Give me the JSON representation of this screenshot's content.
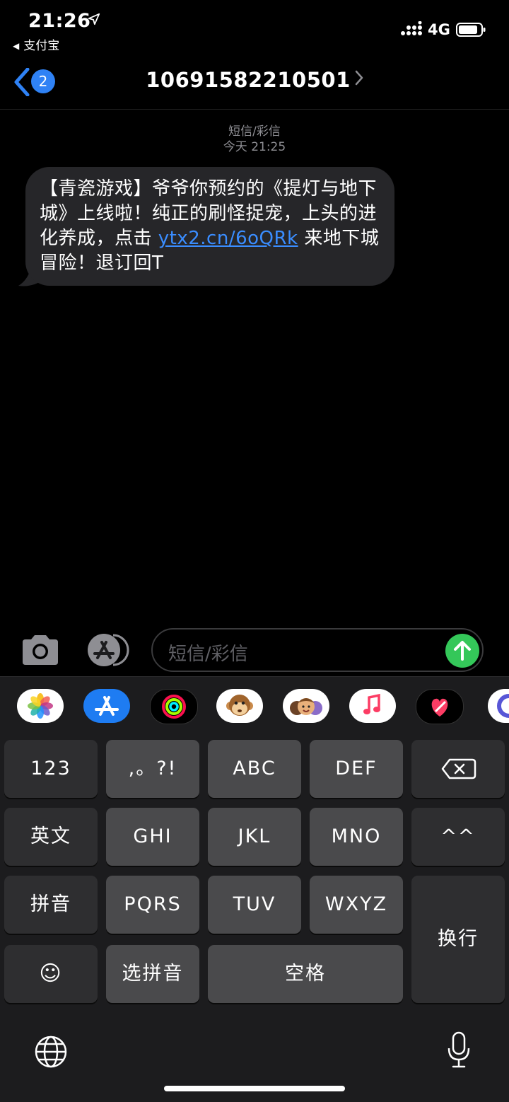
{
  "status_bar": {
    "time": "21:26",
    "back_app": "支付宝",
    "network": "4G"
  },
  "header": {
    "back_badge": "2",
    "title": "10691582210501"
  },
  "thread": {
    "type_label": "短信/彩信",
    "timestamp": "今天 21:25",
    "message": {
      "text_before_link": "【青瓷游戏】爷爷你预约的《提灯与地下城》上线啦！纯正的刷怪捉宠，上头的进化养成，点击 ",
      "link": "ytx2.cn/6oQRk",
      "text_after_link": " 来地下城冒险！退订回T"
    }
  },
  "compose": {
    "placeholder": "短信/彩信"
  },
  "app_drawer": {
    "apps": [
      "photos",
      "app-store",
      "activity",
      "animoji",
      "memoji",
      "music",
      "digital-touch",
      "more"
    ]
  },
  "keyboard": {
    "row1": [
      "123",
      ",。?!",
      "ABC",
      "DEF",
      "⌫"
    ],
    "row2": [
      "英文",
      "GHI",
      "JKL",
      "MNO",
      "^^"
    ],
    "row3": [
      "拼音",
      "PQRS",
      "TUV",
      "WXYZ"
    ],
    "row4": [
      "☺",
      "选拼音",
      "空格"
    ],
    "return_key": "换行"
  },
  "colors": {
    "accent_blue": "#2f82f5",
    "link_blue": "#3a8dff",
    "send_green": "#34c759",
    "bubble": "#262629"
  }
}
